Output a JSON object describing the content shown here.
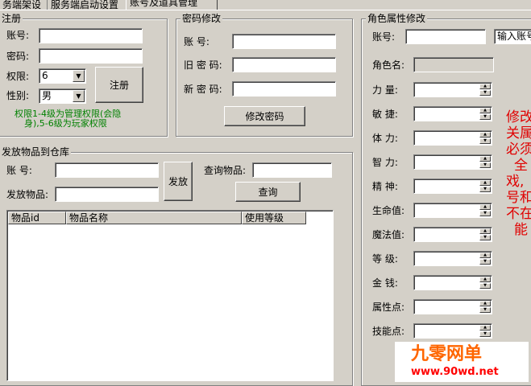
{
  "tabs": [
    "务端架设",
    "服务端启动设置",
    "账号及道具管理"
  ],
  "register": {
    "title": "注册",
    "account_label": "账号:",
    "password_label": "密码:",
    "level_label": "权限:",
    "level_value": "6",
    "gender_label": "性别:",
    "gender_value": "男",
    "register_button": "注册",
    "hint_line1": "权限1-4级为管理权限(会隐",
    "hint_line2": "身),5-6级为玩家权限"
  },
  "password_change": {
    "title": "密码修改",
    "account_label": "账    号:",
    "old_label": "旧 密 码:",
    "new_label": "新 密 码:",
    "button": "修改密码"
  },
  "items": {
    "title": "发放物品到仓库",
    "account_label": "账    号:",
    "item_label": "发放物品:",
    "send_button": "发放",
    "query_label": "查询物品:",
    "query_button": "查询",
    "columns": [
      "物品id",
      "物品名称",
      "使用等级"
    ]
  },
  "role": {
    "title": "角色属性修改",
    "account_label": "账号:",
    "account_placeholder": "输入账号",
    "name_label": "角色名:",
    "fields": [
      "力    量:",
      "敏    捷:",
      "体    力:",
      "智    力:",
      "精    神:",
      "生命值:",
      "魔法值:",
      "等    级:",
      "金    钱:",
      "属性点:",
      "技能点:"
    ]
  },
  "notice": [
    "修改",
    "关属",
    "必须",
    "全",
    "戏,",
    "号和",
    "不在",
    "能"
  ],
  "watermark": {
    "brand": "九零网单",
    "url": "www.90wd.net",
    "brand_color": "#ff6600",
    "url_color": "#ff0000"
  }
}
